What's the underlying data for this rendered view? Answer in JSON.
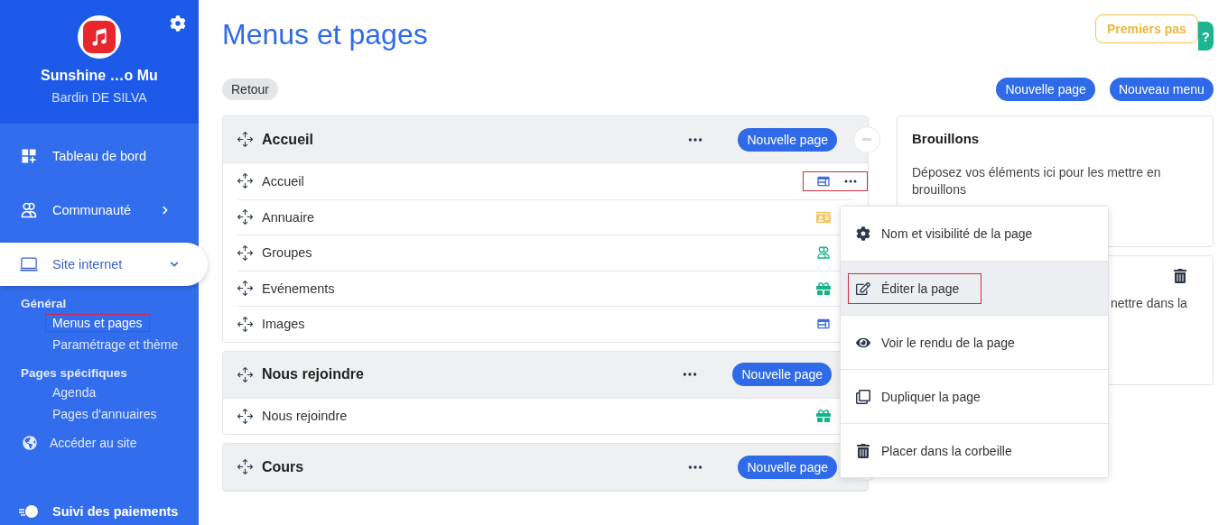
{
  "sidebar": {
    "org_name": "Sunshine …o Mu",
    "user_name": "Bardin DE SILVA",
    "items": [
      {
        "label": "Tableau de bord",
        "kind": "dashboard",
        "selected": false,
        "has_submenu": false
      },
      {
        "label": "Communauté",
        "kind": "community",
        "selected": false,
        "has_submenu": true,
        "expanded": false
      },
      {
        "label": "Site internet",
        "kind": "laptop",
        "selected": true,
        "has_submenu": true,
        "expanded": true
      }
    ],
    "sections": [
      {
        "title": "Général",
        "links": [
          {
            "label": "Menus et pages",
            "highlighted": true
          },
          {
            "label": "Paramétrage et thème",
            "highlighted": false
          }
        ]
      },
      {
        "title": "Pages spécifiques",
        "links": [
          {
            "label": "Agenda",
            "highlighted": false
          },
          {
            "label": "Pages d'annuaires",
            "highlighted": false
          }
        ]
      }
    ],
    "site_link": "Accéder au site",
    "bottom_item": "Suivi des paiements"
  },
  "title": "Menus et pages",
  "help_button": "Premiers pas",
  "help_badge": "?",
  "back_button": "Retour",
  "actions": [
    "Nouvelle page",
    "Nouveau menu"
  ],
  "menus": [
    {
      "title": "Accueil",
      "new_page": "Nouvelle page",
      "collapsible": true,
      "pages": [
        {
          "name": "Accueil",
          "kind": "layout",
          "highlighted": true
        },
        {
          "name": "Annuaire",
          "kind": "directory",
          "highlighted": false
        },
        {
          "name": "Groupes",
          "kind": "groups",
          "highlighted": false
        },
        {
          "name": "Evénements",
          "kind": "gift",
          "highlighted": false
        },
        {
          "name": "Images",
          "kind": "layout",
          "highlighted": false
        }
      ]
    },
    {
      "title": "Nous rejoindre",
      "new_page": "Nouvelle page",
      "collapsible": false,
      "pages": [
        {
          "name": "Nous rejoindre",
          "kind": "gift",
          "highlighted": false
        }
      ]
    },
    {
      "title": "Cours",
      "new_page": "Nouvelle page",
      "collapsible": true
    }
  ],
  "drafts": {
    "title": "Brouillons",
    "text": "Déposez vos éléments ici pour les mettre en brouillons"
  },
  "trash": {
    "text": "nettre dans la"
  },
  "context_menu": [
    {
      "label": "Nom et visibilité de la page",
      "kind": "settings",
      "selected": false,
      "highlighted": false
    },
    {
      "label": "Éditer la page",
      "kind": "edit",
      "selected": true,
      "highlighted": true
    },
    {
      "label": "Voir le rendu de la page",
      "kind": "view",
      "selected": false,
      "highlighted": false
    },
    {
      "label": "Dupliquer la page",
      "kind": "duplicate",
      "selected": false,
      "highlighted": false
    },
    {
      "label": "Placer dans la corbeille",
      "kind": "trash",
      "selected": false,
      "highlighted": false
    }
  ]
}
